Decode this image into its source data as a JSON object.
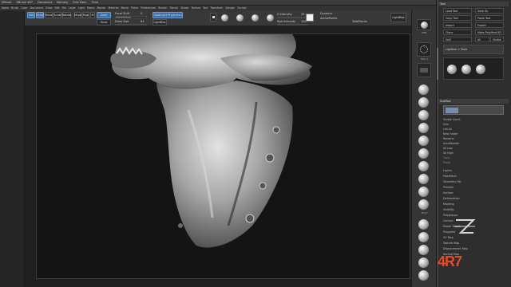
{
  "titlebar": {
    "items": [
      "ZBrush",
      "ZBrush 4R7",
      "Document",
      "Memory",
      "Free Mem",
      "Time"
    ]
  },
  "menubar": {
    "items": [
      "Alpha",
      "Brush",
      "Color",
      "Document",
      "Draw",
      "Edit",
      "File",
      "Layer",
      "Light",
      "Macro",
      "Marker",
      "Material",
      "Movie",
      "Picker",
      "Preferences",
      "Render",
      "Stencil",
      "Stroke",
      "Texture",
      "Tool",
      "Transform",
      "Zplugin",
      "Zscript"
    ]
  },
  "toolbar": {
    "edit_label": "Edit",
    "draw_label": "Draw",
    "move_label": "Move",
    "scale_label": "Scale",
    "rotate_label": "Rotate",
    "mrgb_label": "Mrgb",
    "rgb_label": "Rgb",
    "m_label": "M",
    "zadd_label": "Zadd",
    "zsub_label": "Zsub",
    "focal_shift_label": "Focal Shift",
    "focal_shift_value": "0",
    "draw_size_label": "Draw Size",
    "draw_size_value": "64",
    "z_intensity_label": "Z Intensity",
    "z_intensity_value": "25",
    "rgb_intensity_label": "Rgb Intensity",
    "rgb_intensity_value": "100",
    "dynamic_label": "Dynamic",
    "active_points_label": "ActivePoints",
    "total_points_label": "TotalPoints",
    "spotlight_label": "SpotLight Projection",
    "lightbox_label": "LightBox",
    "focal_shift_fill": 0.5,
    "draw_size_fill": 0.35,
    "z_intensity_fill": 0.25,
    "rgb_intensity_fill": 1.0
  },
  "righttray": {
    "labels": [
      "BPR",
      "SPix 3",
      "Scroll",
      "Zoom",
      "Actual",
      "AAHalf",
      "Persp",
      "Floor",
      "Local",
      "L.Sym",
      "Xpose",
      "Frame",
      "Move",
      "Scale",
      "Rotate",
      "PolyF",
      "Transp",
      "Ghost",
      "Solo"
    ]
  },
  "sidepanel": {
    "header_top": "Tool",
    "buttons": [
      "Load Tool",
      "Save As",
      "Copy Tool",
      "Paste Tool",
      "Import",
      "Export",
      "Clone",
      "Make PolyMesh3D",
      "GoZ",
      "All",
      "Visible",
      "R"
    ],
    "lightbox_label": "Lightbox > Tools",
    "subtool_header": "SubTool",
    "subtool_items": [
      "Visible Count",
      "Solo",
      "List All",
      "New Folder",
      "Rename",
      "AutoReorder",
      "All Low",
      "All High",
      "Copy",
      "Paste",
      "Duplicate",
      "Append",
      "Insert",
      "Delete",
      "Del Other",
      "Del All"
    ],
    "menu_items": [
      "Layers",
      "FiberMesh",
      "Geometry HD",
      "Preview",
      "Surface",
      "Deformation",
      "Masking",
      "Visibility",
      "Polygroups",
      "Contact",
      "Morph Target",
      "Polypaint",
      "UV Map",
      "Texture Map",
      "Displacement Map",
      "Normal Map"
    ]
  },
  "watermark": "4R7",
  "colors": {
    "accent": "#3a6ea5",
    "canvas_bg": "#141414",
    "panel_bg": "#2e2e2e",
    "brand": "#e24a2c"
  }
}
